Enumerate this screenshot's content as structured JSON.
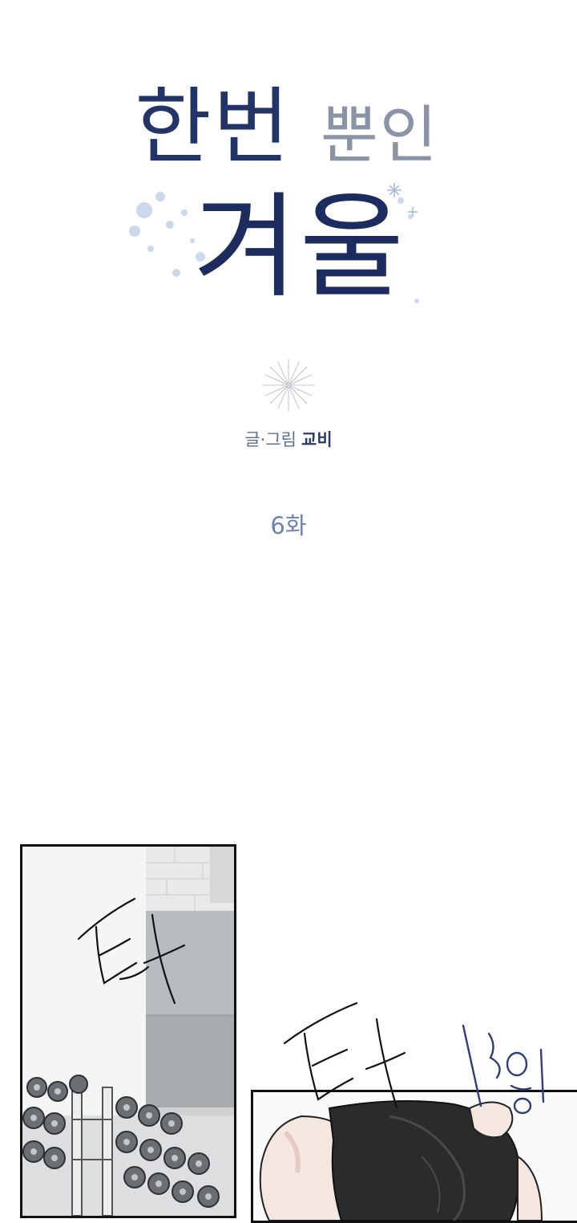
{
  "title": {
    "line1_a": "한번",
    "line1_b": "뿐인",
    "line2": "겨울"
  },
  "credit": {
    "role": "글·그림",
    "author": "교비"
  },
  "episode": "6화",
  "sfx": {
    "left": "탁",
    "middle": "탁",
    "right": "부웅"
  },
  "colors": {
    "title_navy": "#1d2c5e",
    "credit_blue": "#5c6e96",
    "episode_blue": "#6a82b8"
  }
}
